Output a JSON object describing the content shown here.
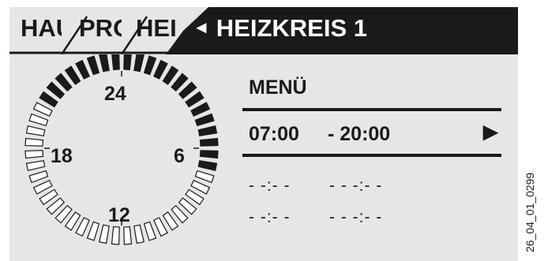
{
  "tabs": [
    {
      "label": "HAU"
    },
    {
      "label": "PRO"
    },
    {
      "label": "HEI"
    }
  ],
  "active_tab": {
    "back_glyph": "◄",
    "title": "HEIZKREIS 1"
  },
  "clock": {
    "hour_labels": {
      "top": "24",
      "right": "6",
      "bottom": "12",
      "left": "18"
    },
    "segments_total": 48,
    "filled_ranges": [
      [
        0,
        7
      ],
      [
        20,
        24
      ]
    ]
  },
  "menu": {
    "title": "MENÜ",
    "selected": {
      "start": "07:00",
      "end": "- 20:00",
      "arrow": "▶"
    },
    "empty_slots": [
      {
        "start": "- -:- -",
        "end": "- - -:- -"
      },
      {
        "start": "- -:- -",
        "end": "- - -:- -"
      }
    ]
  },
  "side_code": "26_04_01_0299",
  "colors": {
    "screen_bg": "#e6e6e6",
    "ink": "#1a1a1a",
    "page_bg": "#ffffff"
  }
}
